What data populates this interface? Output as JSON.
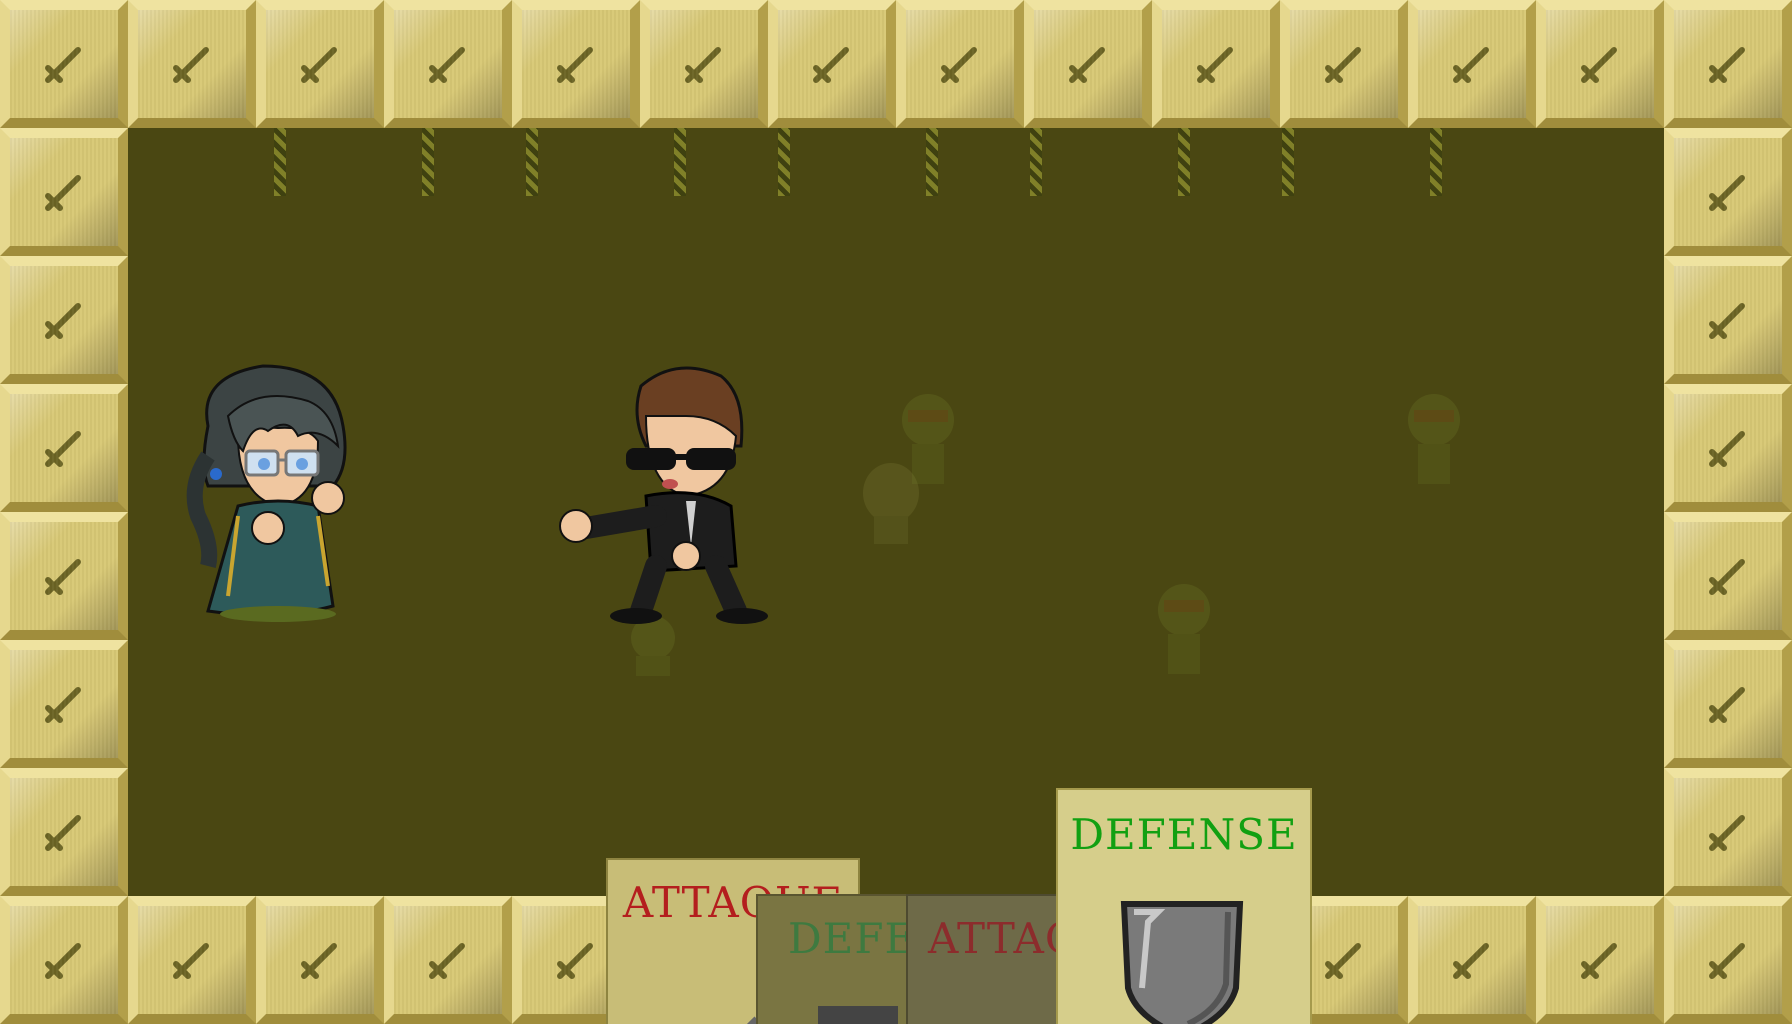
{
  "game": {
    "scene": "battle-arena",
    "colors": {
      "border_tile": "#d8c875",
      "arena_floor": "#4a4712",
      "attack_text": "#b41e1e",
      "defense_text": "#12a012",
      "card_bg": "#c8bd77"
    }
  },
  "cards": [
    {
      "type": "attack",
      "label": "ATTAQUE",
      "state": "stacked",
      "icon": "sword-icon"
    },
    {
      "type": "defense",
      "label": "DEFENSE",
      "state": "stacked-dim",
      "icon": "shield-icon"
    },
    {
      "type": "attack",
      "label": "ATTAQUE",
      "state": "stacked-dim",
      "icon": "sword-icon"
    },
    {
      "type": "defense",
      "label": "DEFENSE",
      "state": "selected",
      "icon": "shield-icon"
    }
  ],
  "characters": {
    "player": "girl-with-glasses",
    "opponent": "man-in-black-suit"
  }
}
